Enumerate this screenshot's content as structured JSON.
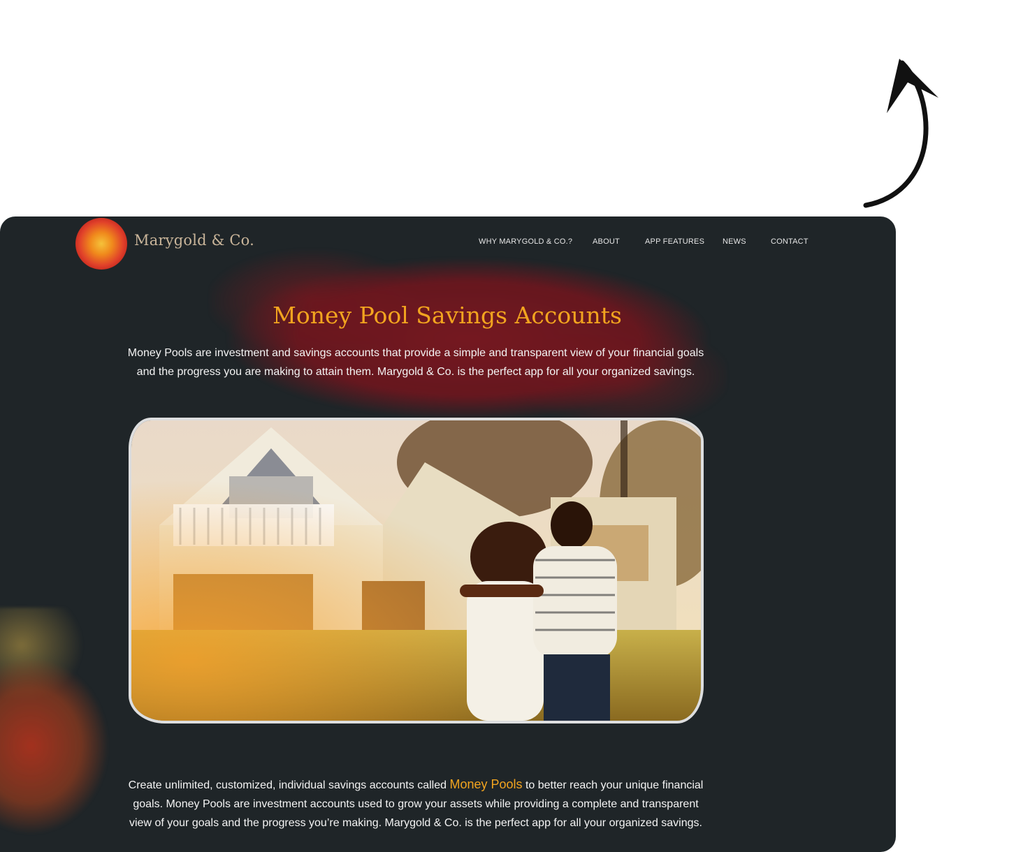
{
  "brand": {
    "name": "Marygold & Co."
  },
  "nav": {
    "items": [
      {
        "label": "WHY MARYGOLD & CO.?"
      },
      {
        "label": "ABOUT"
      },
      {
        "label": "APP FEATURES"
      },
      {
        "label": "NEWS"
      },
      {
        "label": "CONTACT"
      }
    ]
  },
  "hero": {
    "title": "Money Pool Savings Accounts",
    "text": "Money Pools are investment and savings accounts that provide a simple and transparent view of your financial goals and the progress you are making to attain them. Marygold & Co. is the perfect app for all your organized savings."
  },
  "body": {
    "text_before": "Create unlimited, customized, individual savings accounts called ",
    "highlight": "Money Pools",
    "text_after": " to better reach your unique financial goals. Money Pools are investment accounts used to grow your assets while providing a complete and transparent view of your goals and the progress you’re making. Marygold & Co. is the perfect app for all your organized savings."
  },
  "colors": {
    "background": "#1f2528",
    "accent": "#f2a41f",
    "brand_text": "#c9b59a",
    "brush_red": "#7a1820"
  },
  "icons": {
    "annotation": "curved-arrow-icon",
    "logo": "marigold-flower-icon"
  }
}
